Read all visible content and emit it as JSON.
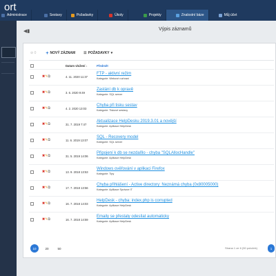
{
  "header": {
    "brand": "ort",
    "nav": [
      {
        "label": "Administrace",
        "icon": "gear-icon",
        "color": "#4a6fa5"
      },
      {
        "label": "Sestavy",
        "icon": "chart-icon",
        "color": "#4a6fa5"
      },
      {
        "label": "Požadavky",
        "icon": "pencil-icon",
        "color": "#e59a1f"
      },
      {
        "label": "Úkoly",
        "icon": "calendar-icon",
        "color": "#d9342b"
      },
      {
        "label": "Projekty",
        "icon": "folder-icon",
        "color": "#3a9a4a"
      },
      {
        "label": "Znalostní báze",
        "icon": "book-icon",
        "color": "#5aa0e0",
        "active": true
      },
      {
        "label": "Můj účet",
        "icon": "user-icon",
        "color": "#7aa3d6"
      }
    ]
  },
  "page": {
    "title": "Výpis záznamů"
  },
  "toolbar": {
    "disabled_label": "0",
    "new_record": "NOVÝ ZÁZNAM",
    "requests": "POŽADAVKY"
  },
  "table": {
    "headers": {
      "date": "Datum vložení",
      "title": "Předmět"
    },
    "rows": [
      {
        "date": "4. 11. 2020 11:37",
        "title": "FTP - aktivní režim",
        "category": "Kategorie: Webové rozhraní"
      },
      {
        "date": "3. 6. 2020 9:49",
        "title": "Zastání db k opravě",
        "category": "Kategorie: SQL server"
      },
      {
        "date": "4. 2. 2020 13:03",
        "title": "Chyba při tisku sestav",
        "category": "Kategorie: Tiskové sestavy"
      },
      {
        "date": "31. 7. 2019 7:47",
        "title": "Aktualizace HelpDesku 2019.3.01 a novější",
        "category": "Kategorie: Aplikace HelpDesk"
      },
      {
        "date": "11. 6. 2019 13:07",
        "title": "SQL - Recovery model",
        "category": "Kategorie: SQL server"
      },
      {
        "date": "31. 5. 2019 14:06",
        "title": "Připojení k db se nezdařilo - chyba \"SQLAllocHandle\"",
        "category": "Kategorie: Aplikace HelpDesk"
      },
      {
        "date": "13. 9. 2018 13:53",
        "title": "Windows ověřování v aplikaci Firefox",
        "category": "Kategorie: Tipy"
      },
      {
        "date": "17. 7. 2018 13:56",
        "title": "Chyba přihlášení - Active directory: Neznámá chyba (0x80005000)",
        "category": "Kategorie: Aplikace Správce IT"
      },
      {
        "date": "16. 7. 2018 14:03",
        "title": "HelpDesk - chyba: index.php is corrupted",
        "category": "Kategorie: Aplikace HelpDesk"
      },
      {
        "date": "16. 7. 2018 14:59",
        "title": "Emaily se přestaly odesílat automaticky",
        "category": "Kategorie: Aplikace HelpDesk"
      }
    ]
  },
  "pagination": {
    "sizes": [
      "10",
      "20",
      "50"
    ],
    "active_size": "10",
    "info": "Strana 1 ze 6 (50 položek)",
    "current_page": "1"
  }
}
